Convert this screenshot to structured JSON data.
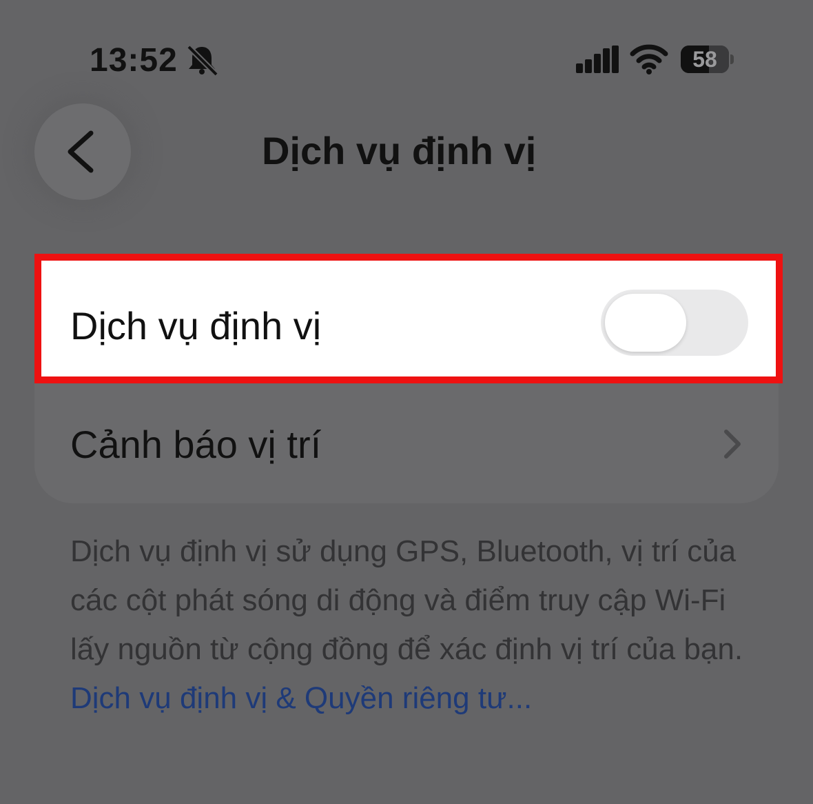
{
  "status_bar": {
    "time": "13:52",
    "battery_level": "58",
    "battery_fraction": 0.58,
    "icons": [
      "bell-slash-icon",
      "cellular-signal-icon",
      "wifi-icon",
      "battery-icon"
    ]
  },
  "nav": {
    "title": "Dịch vụ định vị",
    "back_icon": "chevron-left-icon"
  },
  "settings": {
    "location_services": {
      "label": "Dịch vụ định vị",
      "toggle_on": false
    },
    "location_alerts": {
      "label": "Cảnh báo vị trí",
      "icon": "chevron-right-icon"
    }
  },
  "footer": {
    "text": "Dịch vụ định vị sử dụng GPS, Bluetooth, vị trí của các cột phát sóng di động và điểm truy cập Wi-Fi lấy nguồn từ cộng đồng để xác định vị trí của bạn. ",
    "link": "Dịch vụ định vị & Quyền riêng tư..."
  },
  "colors": {
    "dim_overlay": "#646466",
    "highlight_border": "#ee1111",
    "link": "#1e3a78",
    "toggle_off": "#e9e9ea"
  }
}
